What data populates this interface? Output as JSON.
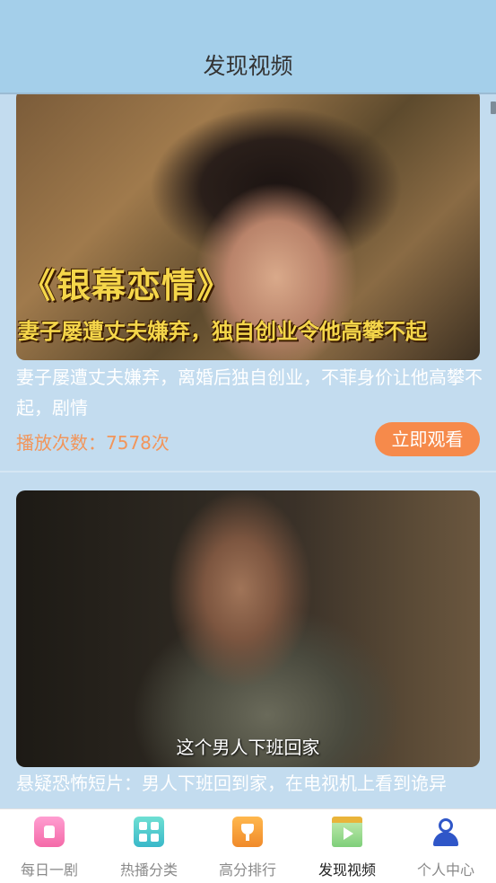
{
  "header": {
    "title": "发现视频"
  },
  "videos": [
    {
      "thumb_title": "《银幕恋情》",
      "thumb_subtitle": "妻子屡遭丈夫嫌弃，独自创业令他高攀不起",
      "description": "妻子屡遭丈夫嫌弃，离婚后独自创业，不菲身价让他高攀不起，剧情",
      "plays_label": "播放次数：",
      "plays_count": "7578次",
      "watch_label": "立即观看"
    },
    {
      "thumb_caption": "这个男人下班回家",
      "description": "悬疑恐怖短片：男人下班回到家，在电视机上看到诡异"
    }
  ],
  "tabbar": {
    "items": [
      {
        "label": "每日一剧",
        "icon": "home-icon"
      },
      {
        "label": "热播分类",
        "icon": "grid-icon"
      },
      {
        "label": "高分排行",
        "icon": "trophy-icon"
      },
      {
        "label": "发现视频",
        "icon": "video-icon",
        "active": true
      },
      {
        "label": "个人中心",
        "icon": "user-icon"
      }
    ]
  },
  "colors": {
    "header_bg": "#a4cfea",
    "page_bg": "#c3dcef",
    "accent": "#f68a4b",
    "plays_text": "#f2955a",
    "thumb_text": "#f5d64a"
  }
}
